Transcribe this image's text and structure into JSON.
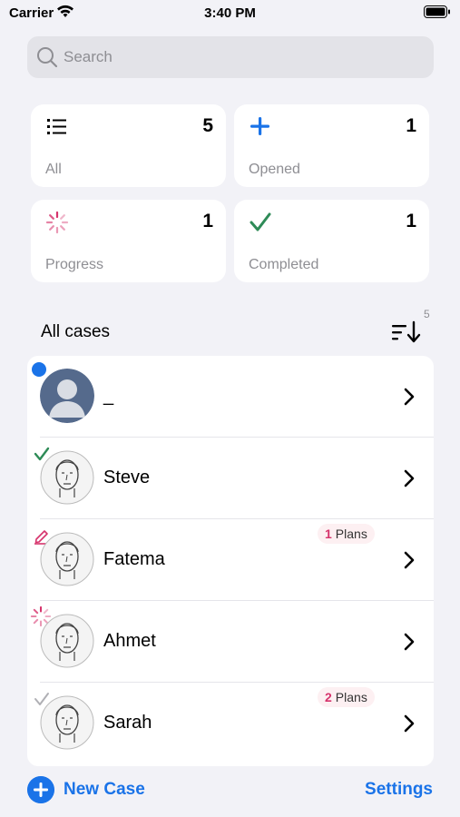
{
  "status_bar": {
    "carrier": "Carrier",
    "time": "3:40 PM"
  },
  "search": {
    "placeholder": "Search"
  },
  "stats": {
    "all": {
      "label": "All",
      "count": "5",
      "icon": "list-icon"
    },
    "opened": {
      "label": "Opened",
      "count": "1",
      "icon": "plus-icon",
      "color": "#1a73e8"
    },
    "progress": {
      "label": "Progress",
      "count": "1",
      "icon": "spinner-icon",
      "color": "#d6336c"
    },
    "completed": {
      "label": "Completed",
      "count": "1",
      "icon": "checkmark-icon",
      "color": "#2e8b57"
    }
  },
  "section": {
    "title": "All cases",
    "sort_count": "5"
  },
  "cases": [
    {
      "name": "_",
      "status": "new-dot",
      "plans": null
    },
    {
      "name": "Steve",
      "status": "completed-check",
      "plans": null
    },
    {
      "name": "Fatema",
      "status": "edit-pencil",
      "plans": {
        "count": "1",
        "label": "Plans"
      }
    },
    {
      "name": "Ahmet",
      "status": "in-progress-spinner",
      "plans": null
    },
    {
      "name": "Sarah",
      "status": "light-check",
      "plans": {
        "count": "2",
        "label": "Plans"
      }
    }
  ],
  "bottom": {
    "new_case": "New Case",
    "settings": "Settings"
  },
  "colors": {
    "accent": "#1a73e8",
    "progress": "#d6336c",
    "success": "#2e8b57"
  }
}
